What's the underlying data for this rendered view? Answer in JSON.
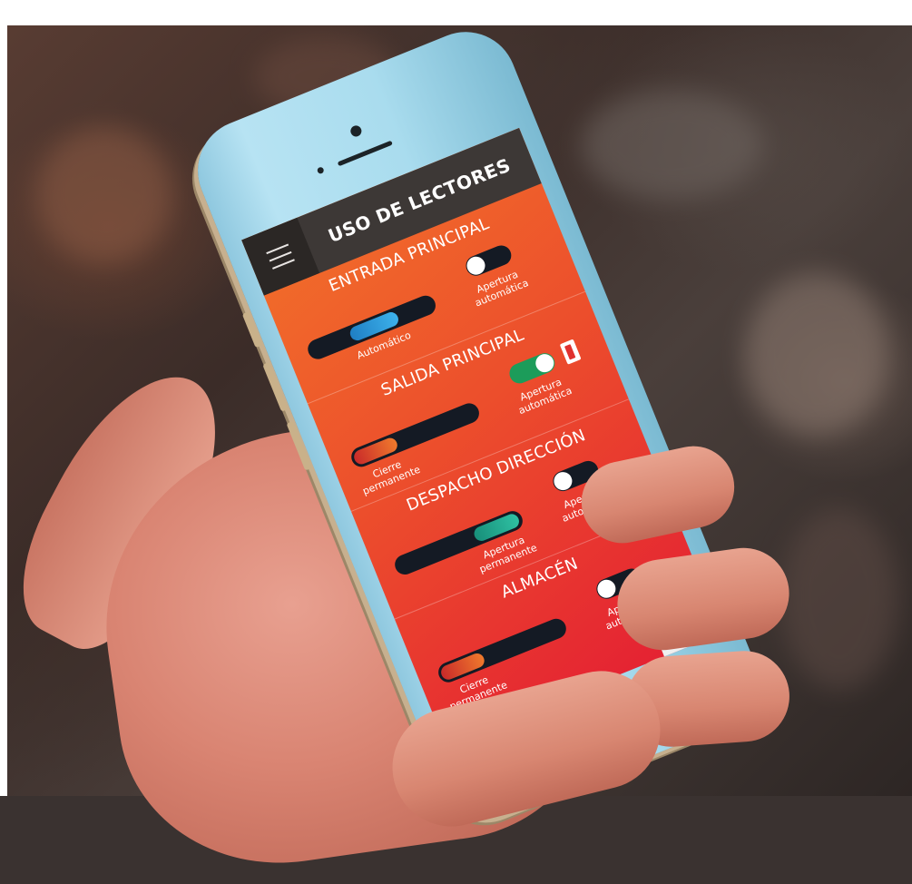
{
  "app": {
    "title": "USO DE LECTORES",
    "menu_icon": "hamburger-menu-icon"
  },
  "colors": {
    "header": "#3d3836",
    "menu_box": "#2b2725",
    "screen_top": "#f2702a",
    "screen_bottom": "#e41f33",
    "track": "#141a24",
    "thumb_auto": "#1a8fd1",
    "thumb_closed": "#e05a2a",
    "thumb_open": "#1fa38a",
    "toggle_on": "#1c9c5a"
  },
  "sections": [
    {
      "title": "ENTRADA PRINCIPAL",
      "mode_label": "Automático",
      "mode_state": "auto",
      "toggle_label": "Apertura automática",
      "toggle_on": false
    },
    {
      "title": "SALIDA PRINCIPAL",
      "mode_label": "Cierre permanente",
      "mode_state": "closed",
      "toggle_label": "Apertura automática",
      "toggle_on": true,
      "extra_icon": "door-open-icon"
    },
    {
      "title": "DESPACHO DIRECCIÓN",
      "mode_label": "Apertura permanente",
      "mode_state": "open",
      "toggle_label": "Apertura automática",
      "toggle_on": false
    },
    {
      "title": "ALMACÉN",
      "mode_label": "Cierre permanente",
      "mode_state": "closed",
      "toggle_label": "Apertura automática",
      "toggle_on": false
    }
  ]
}
